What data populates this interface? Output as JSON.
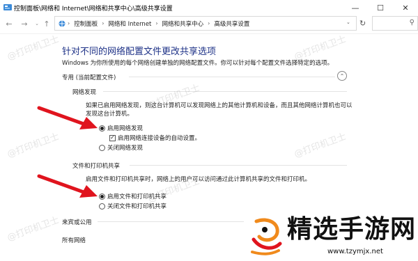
{
  "window": {
    "title": "控制面板\\网络和 Internet\\网络和共享中心\\高级共享设置",
    "minimize_icon": "minimize-icon",
    "maximize_icon": "maximize-icon",
    "close_icon": "close-icon"
  },
  "address_bar": {
    "crumbs": [
      "控制面板",
      "网络和 Internet",
      "网络和共享中心",
      "高级共享设置"
    ]
  },
  "main": {
    "heading": "针对不同的网络配置文件更改共享选项",
    "subtext": "Windows 为你所使用的每个网络创建单独的网络配置文件。你可以针对每个配置文件选择特定的选项。",
    "profile_private": "专用 (当前配置文件)",
    "profile_guest": "来宾或公用",
    "profile_all": "所有网络",
    "discovery": {
      "title": "网络发现",
      "desc": "如果已启用网络发现，则这台计算机可以发现网络上的其他计算机和设备，而且其他网络计算机也可以发现这台计算机。",
      "opt_on": "启用网络发现",
      "auto_setup": "启用网络连接设备的自动设置。",
      "opt_off": "关闭网络发现",
      "selected": "on"
    },
    "sharing": {
      "title": "文件和打印机共享",
      "desc": "启用文件和打印机共享时，网络上的用户可以访问通过此计算机共享的文件和打印机。",
      "opt_on": "启用文件和打印机共享",
      "opt_off": "关闭文件和打印机共享",
      "selected": "on"
    }
  },
  "watermark": "@打印机卫士",
  "logo": {
    "brand": "精选手游网",
    "url": "www.tzymjx.net"
  },
  "colors": {
    "heading": "#1e3287",
    "arrow": "#e0141e",
    "logo_orange": "#f08a1c"
  }
}
